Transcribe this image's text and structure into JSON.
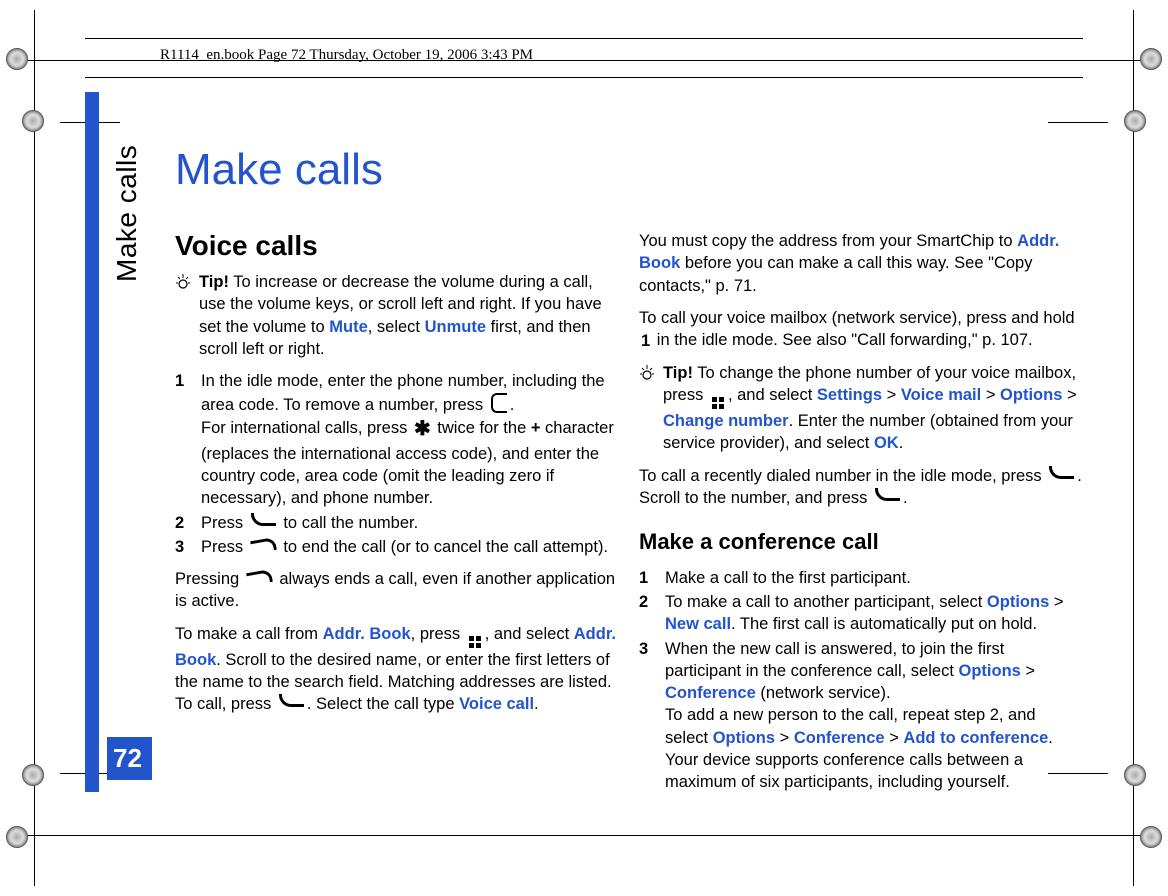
{
  "header": "R1114_en.book  Page 72  Thursday, October 19, 2006  3:43 PM",
  "sideLabel": "Make calls",
  "pageNumber": "72",
  "title": "Make calls",
  "left": {
    "h2": "Voice calls",
    "tipLabel": "Tip!",
    "tipText1": " To increase or decrease the volume during a call, use the volume keys, or scroll left and right. If you have set the volume to ",
    "mute": "Mute",
    "tipText2": ", select ",
    "unmute": "Unmute",
    "tipText3": " first, and then scroll left or right.",
    "step1a": "In the idle mode, enter the phone number, including the area code. To remove a number, press ",
    "step1b": ".",
    "step1c": "For international calls, press ",
    "step1d": " twice for the ",
    "plus": "+",
    "step1e": " character (replaces the international access code), and enter the country code, area code (omit the leading zero if necessary), and phone number.",
    "step2a": "Press ",
    "step2b": " to call the number.",
    "step3a": "Press ",
    "step3b": " to end the call (or to cancel the call attempt).",
    "para1a": "Pressing ",
    "para1b": " always ends a call, even if another application is active.",
    "para2a": "To make a call from ",
    "addrbook": "Addr. Book",
    "para2b": ", press ",
    "para2c": ", and select ",
    "para2d": ". Scroll to the desired name, or enter the first letters of the name to the search field. Matching addresses are listed. To call, press ",
    "para2e": ". Select the call type ",
    "voicecall": "Voice call",
    "period": "."
  },
  "right": {
    "para1a": "You must copy the address from your SmartChip to ",
    "addrbook": "Addr. Book",
    "para1b": " before you can make a call this way. See \"Copy contacts,\" p. 71.",
    "para2a": "To call your voice mailbox (network service), press and hold ",
    "para2b": " in the idle mode. See also \"Call forwarding,\" p. 107.",
    "tipLabel": "Tip!",
    "tip2a": " To change the phone number of your voice mailbox, press ",
    "tip2b": ", and select ",
    "settings": "Settings",
    "gt": " > ",
    "voicemail": "Voice mail",
    "options": "Options",
    "changenum": "Change number",
    "tip2c": ". Enter the number (obtained from your service provider), and select ",
    "ok": "OK",
    "period": ".",
    "para3a": "To call a recently dialed number in the idle mode, press ",
    "para3b": ". Scroll to the number, and press ",
    "h3": "Make a conference call",
    "c1": "Make a call to the first participant.",
    "c2a": "To make a call to another participant, select ",
    "newcall": "New call",
    "c2b": ". The first call is automatically put on hold.",
    "c3a": "When the new call is answered, to join the first participant in the conference call, select ",
    "conference": "Conference",
    "c3b": " (network service).",
    "c3c": "To add a new person to the call, repeat step 2, and select ",
    "addtoconf": "Add to conference",
    "c3d": ". Your device supports conference calls between a maximum of six participants, including yourself."
  }
}
